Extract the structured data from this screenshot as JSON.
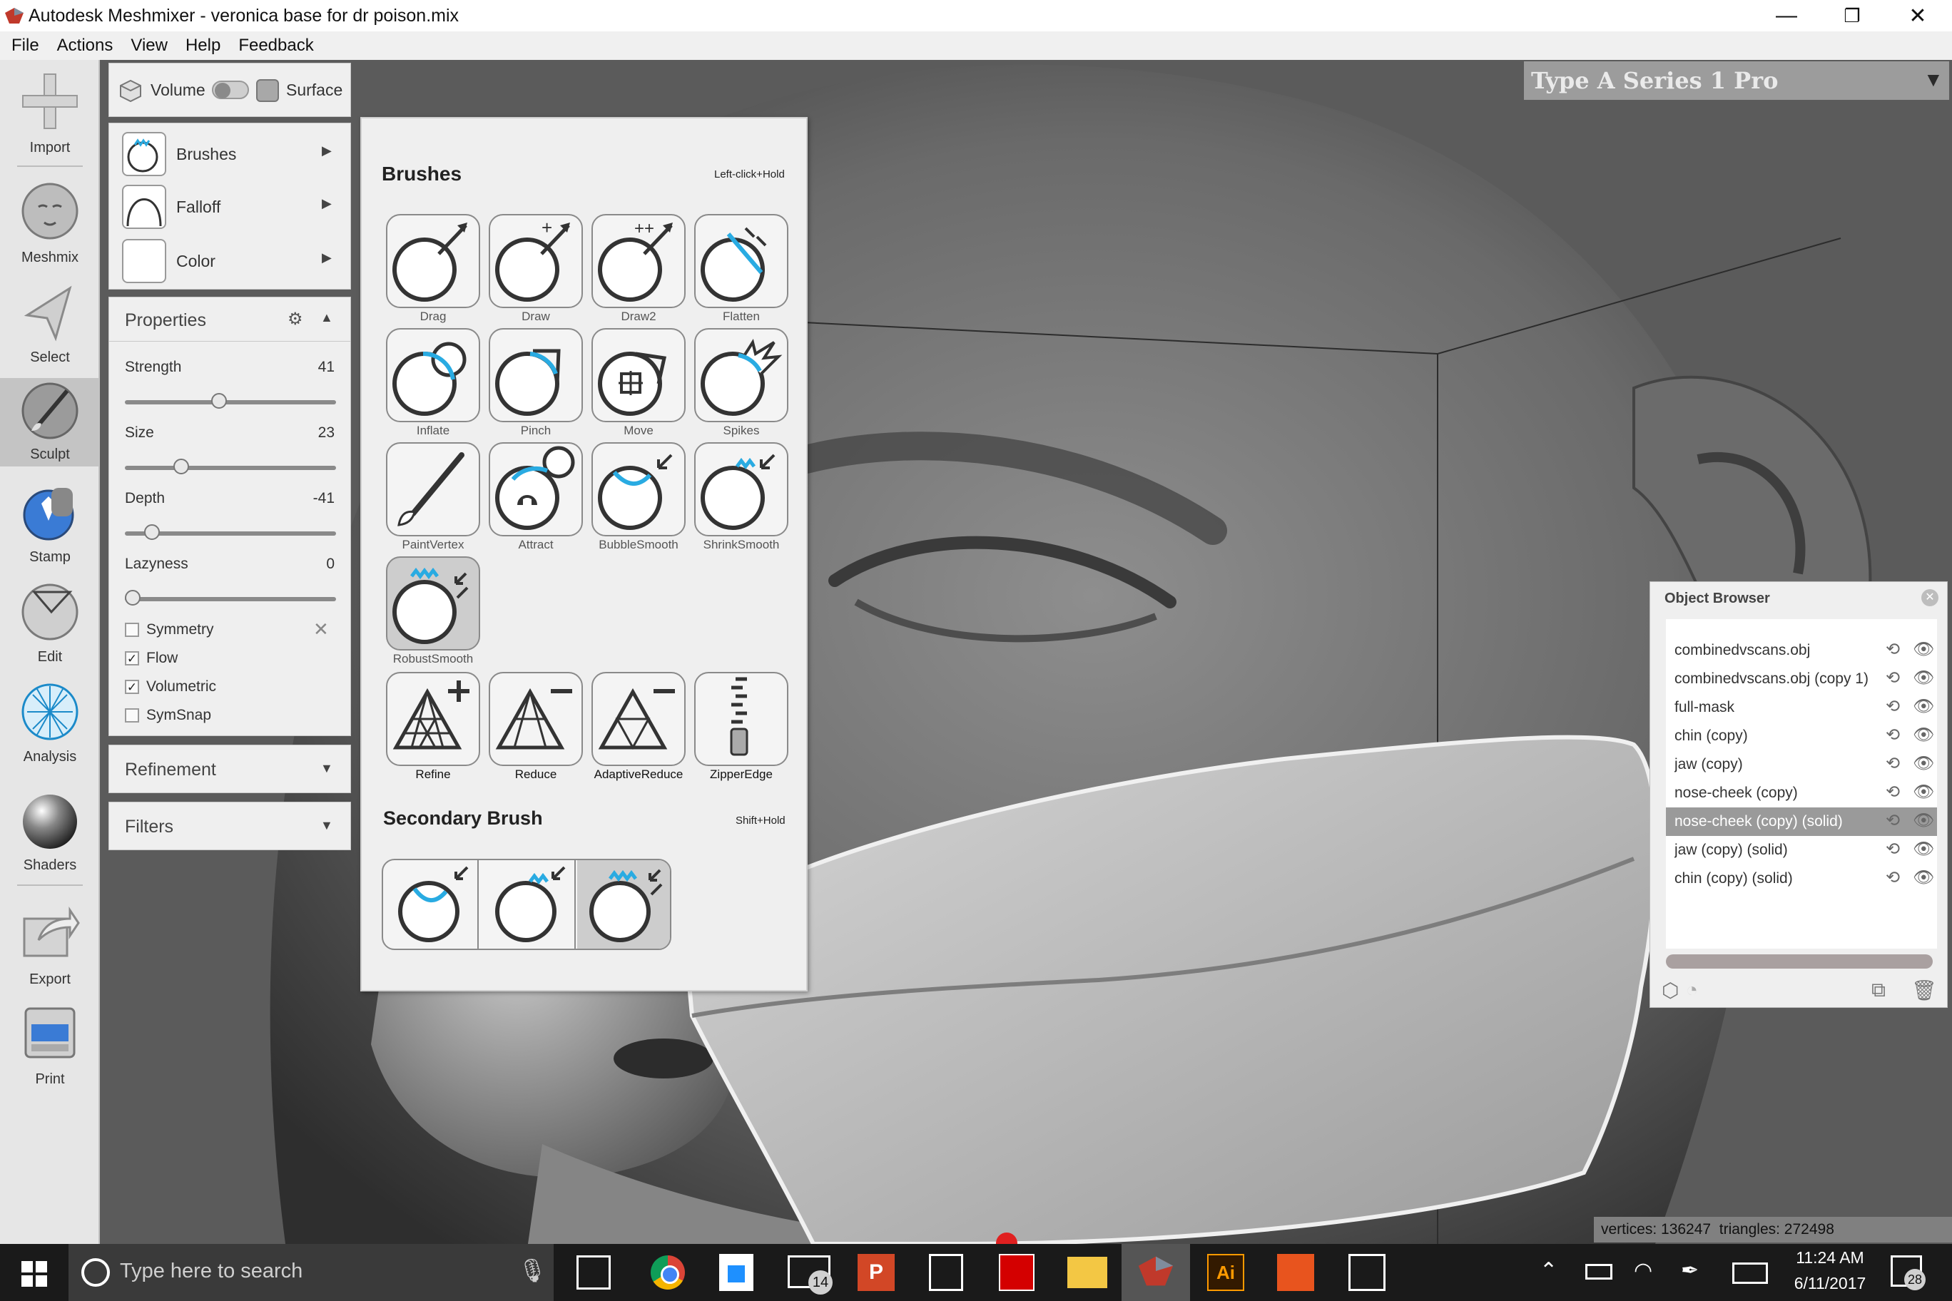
{
  "window": {
    "title": "Autodesk Meshmixer - veronica base for dr poison.mix",
    "minimize": "—",
    "restore": "❐",
    "close": "✕"
  },
  "menu": [
    "File",
    "Actions",
    "View",
    "Help",
    "Feedback"
  ],
  "toolbar": [
    {
      "label": "Import",
      "icon": "plus-icon"
    },
    {
      "label": "Meshmix",
      "icon": "head-icon"
    },
    {
      "label": "Select",
      "icon": "select-arrow-icon"
    },
    {
      "label": "Sculpt",
      "icon": "brush-icon"
    },
    {
      "label": "Stamp",
      "icon": "stamp-icon"
    },
    {
      "label": "Edit",
      "icon": "edit-sphere-icon"
    },
    {
      "label": "Analysis",
      "icon": "analysis-icon"
    },
    {
      "label": "Shaders",
      "icon": "shader-sphere-icon"
    },
    {
      "label": "Export",
      "icon": "export-icon"
    },
    {
      "label": "Print",
      "icon": "printer-icon"
    }
  ],
  "mode": {
    "volume": "Volume",
    "surface": "Surface"
  },
  "brush_menu": {
    "brushes": "Brushes",
    "falloff": "Falloff",
    "color": "Color"
  },
  "properties": {
    "title": "Properties",
    "strength": {
      "label": "Strength",
      "value": "41",
      "fraction": 0.41
    },
    "size": {
      "label": "Size",
      "value": "23",
      "fraction": 0.23
    },
    "depth": {
      "label": "Depth",
      "value": "-41",
      "fraction": 0.09
    },
    "lazyness": {
      "label": "Lazyness",
      "value": "0",
      "fraction": 0.0
    },
    "checks": [
      {
        "label": "Symmetry",
        "checked": false
      },
      {
        "label": "Flow",
        "checked": true
      },
      {
        "label": "Volumetric",
        "checked": true
      },
      {
        "label": "SymSnap",
        "checked": false
      }
    ]
  },
  "refinement": "Refinement",
  "filters": "Filters",
  "brushes_popup": {
    "title": "Brushes",
    "hint": "Left-click+Hold",
    "items": [
      "Drag",
      "Draw",
      "Draw2",
      "Flatten",
      "Inflate",
      "Pinch",
      "Move",
      "Spikes",
      "PaintVertex",
      "Attract",
      "BubbleSmooth",
      "ShrinkSmooth",
      "RobustSmooth"
    ],
    "refine_items": [
      "Refine",
      "Reduce",
      "AdaptiveReduce",
      "ZipperEdge"
    ],
    "secondary_title": "Secondary Brush",
    "secondary_hint": "Shift+Hold"
  },
  "printer": {
    "name": "Type A Series 1 Pro",
    "arrow": "▼"
  },
  "object_browser": {
    "title": "Object Browser",
    "items": [
      "combinedvscans.obj",
      "combinedvscans.obj (copy 1)",
      "full-mask",
      "chin (copy)",
      "jaw (copy)",
      "nose-cheek (copy)",
      "nose-cheek (copy) (solid)",
      "jaw (copy) (solid)",
      "chin (copy) (solid)"
    ],
    "selected_index": 6
  },
  "status": "vertices: 136247  triangles: 272498",
  "taskbar": {
    "search_placeholder": "Type here to search",
    "time": "11:24 AM",
    "date": "6/11/2017",
    "mail_badge": "14",
    "notif_badge": "28"
  },
  "colors": {
    "accent": "#29abe2",
    "selection": "#9a9a9a"
  }
}
